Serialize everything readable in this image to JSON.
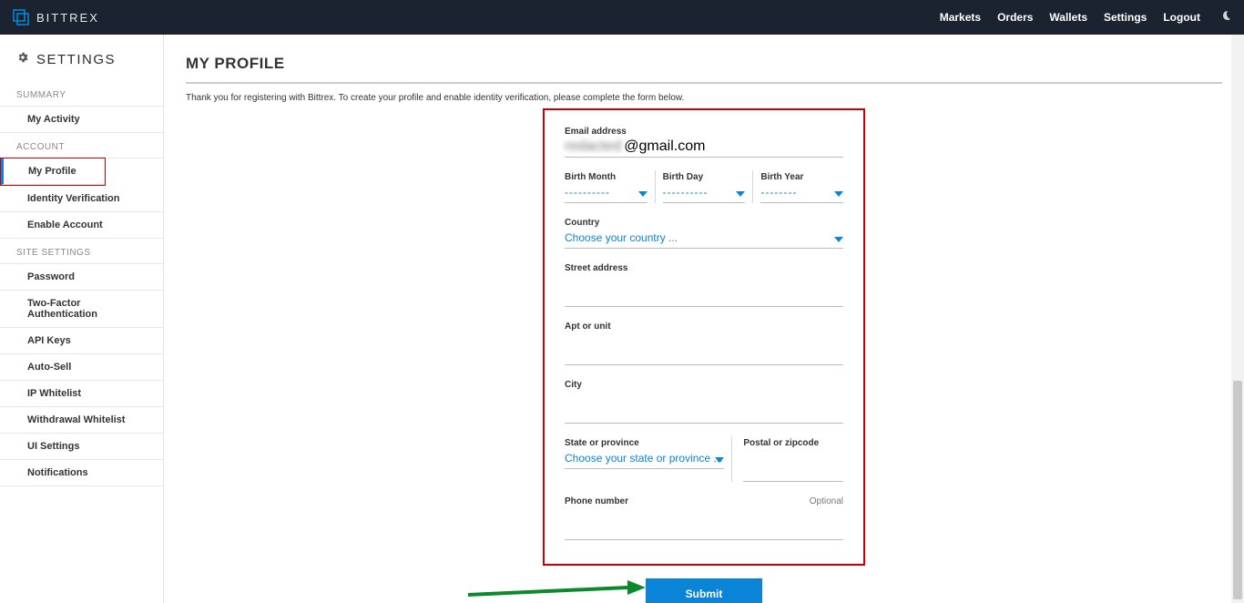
{
  "header": {
    "brand": "BITTREX",
    "nav": {
      "markets": "Markets",
      "orders": "Orders",
      "wallets": "Wallets",
      "settings": "Settings",
      "logout": "Logout"
    }
  },
  "sidebar": {
    "title": "SETTINGS",
    "sections": {
      "summary": {
        "label": "SUMMARY",
        "items": {
          "activity": "My Activity"
        }
      },
      "account": {
        "label": "ACCOUNT",
        "items": {
          "profile": "My Profile",
          "identity": "Identity Verification",
          "enable": "Enable Account"
        }
      },
      "site": {
        "label": "SITE SETTINGS",
        "items": {
          "password": "Password",
          "twofa": "Two-Factor Authentication",
          "apikeys": "API Keys",
          "autosell": "Auto-Sell",
          "ipwhite": "IP Whitelist",
          "wwhite": "Withdrawal Whitelist",
          "uiset": "UI Settings",
          "notif": "Notifications"
        }
      }
    }
  },
  "page": {
    "title": "MY PROFILE",
    "intro": "Thank you for registering with Bittrex. To create your profile and enable identity verification, please complete the form below."
  },
  "form": {
    "email_label": "Email address",
    "email_prefix": "redacted",
    "email_suffix": "@gmail.com",
    "birth_month_label": "Birth Month",
    "birth_day_label": "Birth Day",
    "birth_year_label": "Birth Year",
    "dashes": "----------",
    "dashes_short": "--------",
    "country_label": "Country",
    "country_placeholder": "Choose your country ...",
    "street_label": "Street address",
    "apt_label": "Apt or unit",
    "city_label": "City",
    "state_label": "State or province",
    "state_placeholder": "Choose your state or province ...",
    "postal_label": "Postal or zipcode",
    "phone_label": "Phone number",
    "phone_optional": "Optional",
    "submit": "Submit"
  }
}
